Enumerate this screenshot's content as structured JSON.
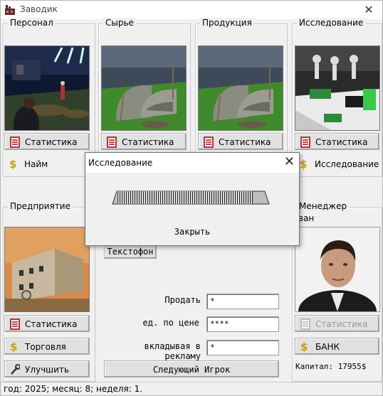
{
  "window": {
    "title": "Заводик",
    "close_glyph": "✕"
  },
  "groups": {
    "personnel": {
      "label": "Персонал",
      "stats_label": "Статистика",
      "hire_label": "Найм"
    },
    "raw": {
      "label": "Сырье",
      "stats_label": "Статистика"
    },
    "products": {
      "label": "Продукция",
      "stats_label": "Статистика"
    },
    "research": {
      "label": "Исследование",
      "stats_label": "Статистика",
      "research_label": "Исследование"
    },
    "enterprise": {
      "label": "Предприятие",
      "stats_label": "Статистика",
      "trade_label": "Торговля",
      "improve_label": "Улучшить"
    },
    "manager": {
      "label": "Менеджер",
      "name_fragment": "ван",
      "stats_label": "Статистика",
      "bank_label": "БАНК",
      "capital_text": "Капитал: 17955$"
    }
  },
  "center": {
    "textophone_label": "Текстофон",
    "sell_label": "Продать",
    "sell_value": "*",
    "price_label": "ед. по цене",
    "price_value": "****",
    "ads_label": "вкладывая в рекламу",
    "ads_value": "*",
    "next_player_label": "Следующий Игрок"
  },
  "dialog": {
    "title": "Исследование",
    "close_glyph": "✕",
    "close_button_label": "Закрыть",
    "progress": 0.92
  },
  "status": {
    "text": "год: 2025; месяц: 8; неделя: 1."
  },
  "icons": {
    "app": "app-icon",
    "stats": "stats-document-icon",
    "money": "dollar-icon",
    "improve": "wrench-icon"
  },
  "colors": {
    "window_bg": "#f0f0f0",
    "dollar": "#c8a000",
    "stats_red": "#c00000"
  }
}
